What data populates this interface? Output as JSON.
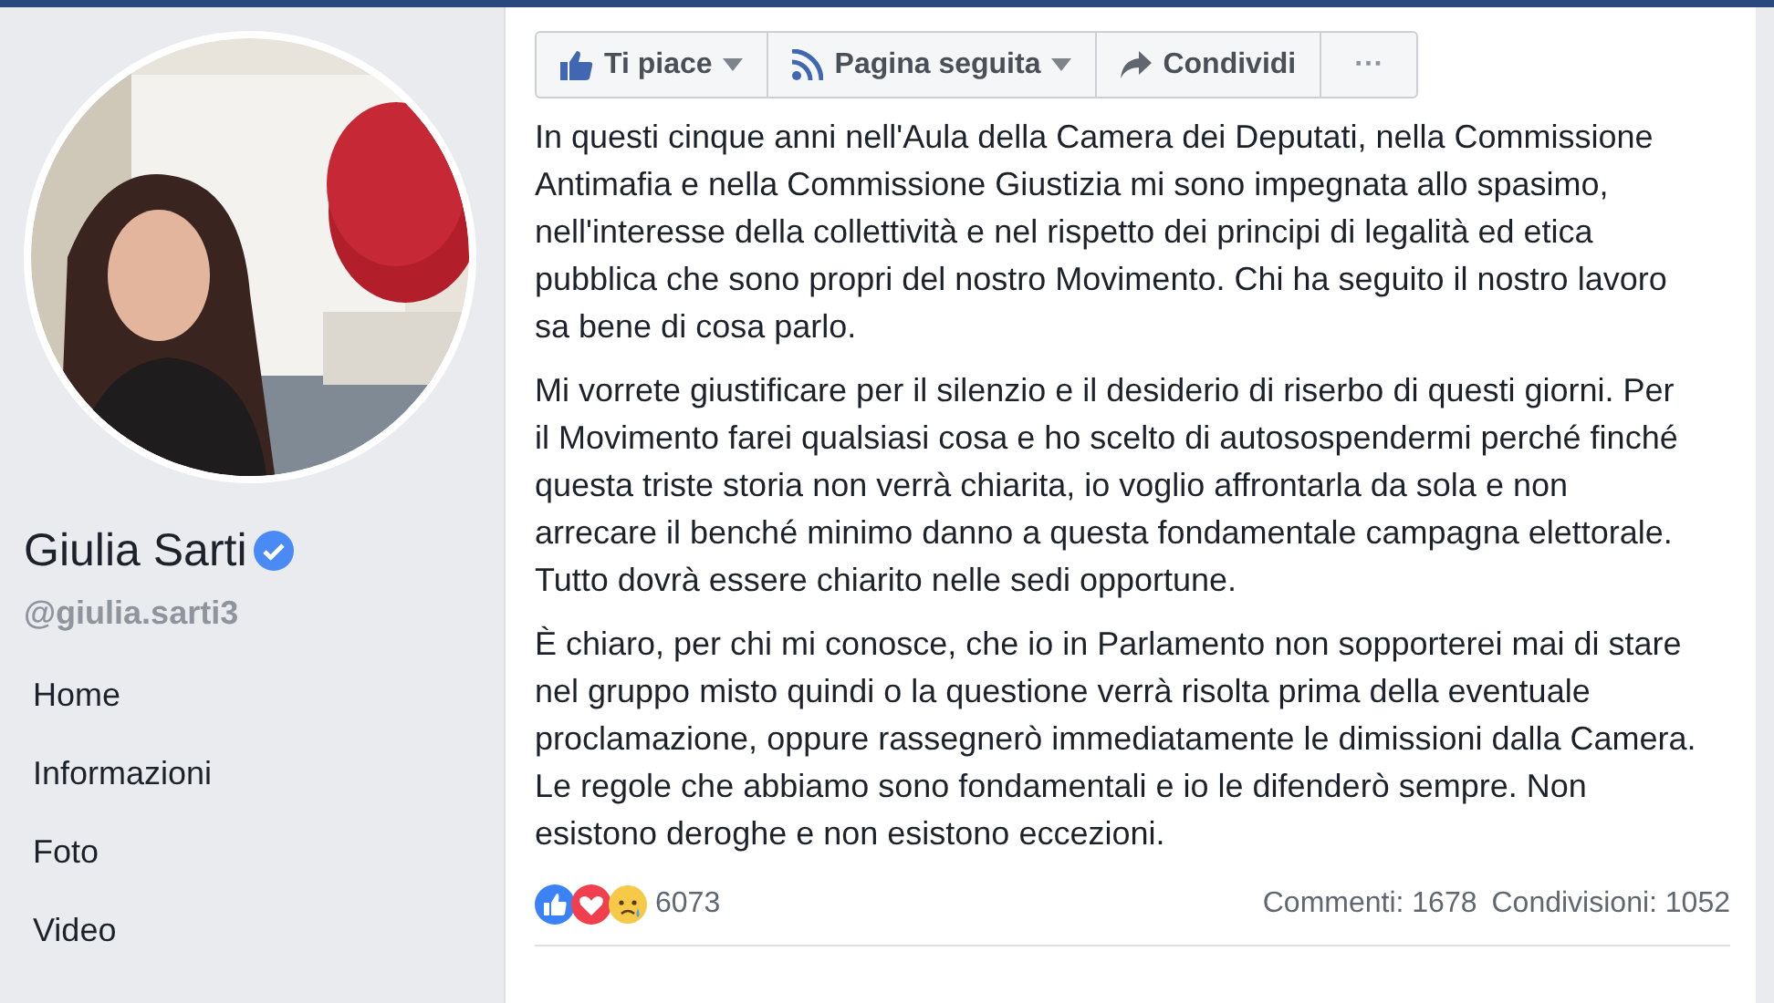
{
  "profile": {
    "kind": "picture",
    "name": "Giulia Sarti",
    "verified": true,
    "username": "@giulia.sarti3"
  },
  "nav": [
    {
      "label": "Home"
    },
    {
      "label": "Informazioni"
    },
    {
      "label": "Foto"
    },
    {
      "label": "Video"
    }
  ],
  "actions": [
    {
      "kind": "like",
      "label": "Ti piace",
      "dropdown": true
    },
    {
      "kind": "follow",
      "label": "Pagina seguita",
      "dropdown": true
    },
    {
      "kind": "share",
      "label": "Condividi",
      "dropdown": false
    },
    {
      "kind": "more",
      "label": "···",
      "dropdown": false
    }
  ],
  "post": {
    "paragraphs": [
      "In questi cinque anni nell'Aula della Camera dei Deputati, nella Commissione Antimafia e nella Commissione Giustizia mi sono impegnata allo spasimo, nell'interesse della collettività e nel rispetto dei principi di legalità ed etica pubblica che sono propri del nostro Movimento. Chi ha seguito il nostro lavoro sa bene di cosa parlo.",
      "Mi vorrete giustificare per il silenzio e il desiderio di riserbo di questi giorni. Per il Movimento farei qualsiasi cosa e ho scelto di autosospendermi perché finché questa triste storia non verrà chiarita, io voglio affrontarla da sola e non arrecare il benché minimo danno a questa fondamentale campagna elettorale.\nTutto dovrà essere chiarito nelle sedi opportune.",
      "È chiaro, per chi mi conosce, che io in Parlamento non sopporterei mai di stare nel gruppo misto quindi o la questione verrà risolta prima della eventuale proclamazione, oppure rassegnerò immediatamente le dimissioni dalla Camera. Le regole che abbiamo sono fondamentali e io le difenderò sempre. Non esistono deroghe e non esistono eccezioni."
    ],
    "reactions": [
      {
        "kind": "like"
      },
      {
        "kind": "love"
      },
      {
        "kind": "sad"
      }
    ],
    "reaction_count": "6073",
    "comments": "Commenti: 1678",
    "shares": "Condivisioni: 1052"
  }
}
